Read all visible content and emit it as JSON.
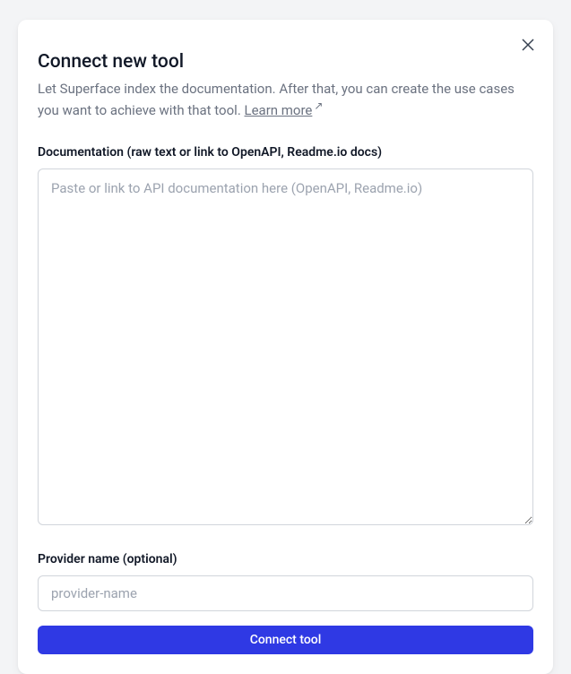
{
  "modal": {
    "title": "Connect new tool",
    "description_part1": "Let Superface index the documentation. After that, you can create the use cases you want to achieve with that tool. ",
    "learn_more_label": "Learn more",
    "fields": {
      "documentation": {
        "label": "Documentation (raw text or link to OpenAPI, Readme.io docs)",
        "placeholder": "Paste or link to API documentation here (OpenAPI, Readme.io)"
      },
      "provider": {
        "label": "Provider name (optional)",
        "placeholder": "provider-name"
      }
    },
    "submit_label": "Connect tool"
  }
}
